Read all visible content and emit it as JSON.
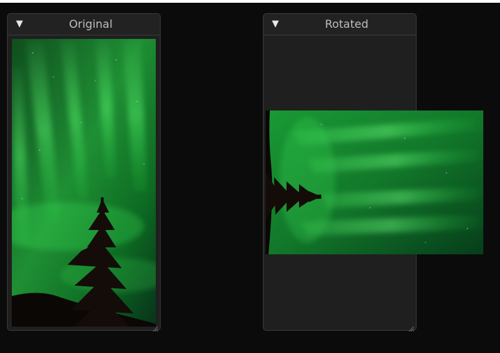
{
  "windows": {
    "original": {
      "title": "Original",
      "collapse_icon": "triangle-down-icon"
    },
    "rotated": {
      "title": "Rotated",
      "collapse_icon": "triangle-down-icon"
    }
  },
  "images": {
    "original_subject": "green aurora over silhouetted spruce tree",
    "rotated_subject": "green aurora over silhouetted spruce tree, rotated 90 degrees"
  },
  "colors": {
    "background": "#0b0b0b",
    "panel": "#1f1f1f",
    "panel_border": "#3a3a3a",
    "title_text": "#bdbdbd",
    "aurora_green": "#22b83a"
  }
}
